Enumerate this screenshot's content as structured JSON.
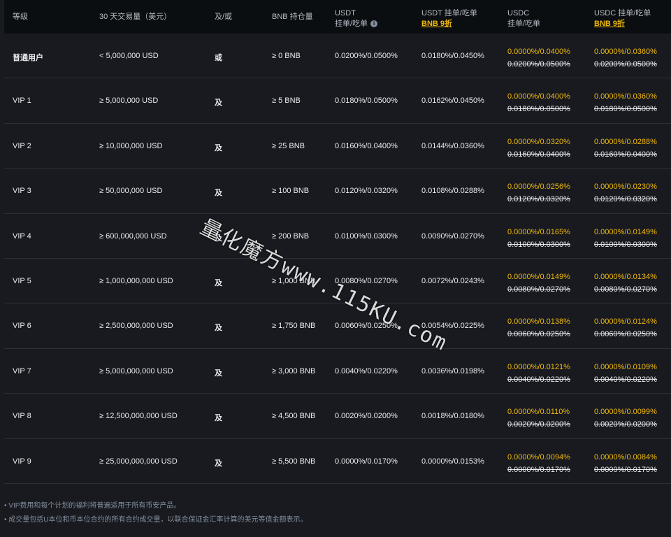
{
  "header": {
    "level": "等级",
    "volume": "30 天交易量（美元）",
    "andor": "及/或",
    "bnb": "BNB 持仓量",
    "usdt_title": "USDT",
    "usdt_sub": "挂单/吃单",
    "usdt_bnb_title": "USDT 挂单/吃单",
    "usdt_bnb_link": "BNB 9折",
    "usdc_title": "USDC",
    "usdc_sub": "挂单/吃单",
    "usdc_bnb_title": "USDC 挂单/吃单",
    "usdc_bnb_link": "BNB 9折"
  },
  "rows": [
    {
      "level": "普通用户",
      "volume": "< 5,000,000 USD",
      "andor": "或",
      "bnb": "≥ 0 BNB",
      "usdt": "0.0200%/0.0500%",
      "usdt_bnb": "0.0180%/0.0450%",
      "usdc_new": "0.0000%/0.0400%",
      "usdc_old": "0.0200%/0.0500%",
      "usdc_bnb_new": "0.0000%/0.0360%",
      "usdc_bnb_old": "0.0200%/0.0500%"
    },
    {
      "level": "VIP 1",
      "volume": "≥ 5,000,000 USD",
      "andor": "及",
      "bnb": "≥ 5 BNB",
      "usdt": "0.0180%/0.0500%",
      "usdt_bnb": "0.0162%/0.0450%",
      "usdc_new": "0.0000%/0.0400%",
      "usdc_old": "0.0180%/0.0500%",
      "usdc_bnb_new": "0.0000%/0.0360%",
      "usdc_bnb_old": "0.0180%/0.0500%"
    },
    {
      "level": "VIP 2",
      "volume": "≥ 10,000,000 USD",
      "andor": "及",
      "bnb": "≥ 25 BNB",
      "usdt": "0.0160%/0.0400%",
      "usdt_bnb": "0.0144%/0.0360%",
      "usdc_new": "0.0000%/0.0320%",
      "usdc_old": "0.0160%/0.0400%",
      "usdc_bnb_new": "0.0000%/0.0288%",
      "usdc_bnb_old": "0.0160%/0.0400%"
    },
    {
      "level": "VIP 3",
      "volume": "≥ 50,000,000 USD",
      "andor": "及",
      "bnb": "≥ 100 BNB",
      "usdt": "0.0120%/0.0320%",
      "usdt_bnb": "0.0108%/0.0288%",
      "usdc_new": "0.0000%/0.0256%",
      "usdc_old": "0.0120%/0.0320%",
      "usdc_bnb_new": "0.0000%/0.0230%",
      "usdc_bnb_old": "0.0120%/0.0320%"
    },
    {
      "level": "VIP 4",
      "volume": "≥ 600,000,000 USD",
      "andor": "及",
      "bnb": "≥ 200 BNB",
      "usdt": "0.0100%/0.0300%",
      "usdt_bnb": "0.0090%/0.0270%",
      "usdc_new": "0.0000%/0.0165%",
      "usdc_old": "0.0100%/0.0300%",
      "usdc_bnb_new": "0.0000%/0.0149%",
      "usdc_bnb_old": "0.0100%/0.0300%"
    },
    {
      "level": "VIP 5",
      "volume": "≥ 1,000,000,000 USD",
      "andor": "及",
      "bnb": "≥ 1,000 BNB",
      "usdt": "0.0080%/0.0270%",
      "usdt_bnb": "0.0072%/0.0243%",
      "usdc_new": "0.0000%/0.0149%",
      "usdc_old": "0.0080%/0.0270%",
      "usdc_bnb_new": "0.0000%/0.0134%",
      "usdc_bnb_old": "0.0080%/0.0270%"
    },
    {
      "level": "VIP 6",
      "volume": "≥ 2,500,000,000 USD",
      "andor": "及",
      "bnb": "≥ 1,750 BNB",
      "usdt": "0.0060%/0.0250%",
      "usdt_bnb": "0.0054%/0.0225%",
      "usdc_new": "0.0000%/0.0138%",
      "usdc_old": "0.0060%/0.0250%",
      "usdc_bnb_new": "0.0000%/0.0124%",
      "usdc_bnb_old": "0.0060%/0.0250%"
    },
    {
      "level": "VIP 7",
      "volume": "≥ 5,000,000,000 USD",
      "andor": "及",
      "bnb": "≥ 3,000 BNB",
      "usdt": "0.0040%/0.0220%",
      "usdt_bnb": "0.0036%/0.0198%",
      "usdc_new": "0.0000%/0.0121%",
      "usdc_old": "0.0040%/0.0220%",
      "usdc_bnb_new": "0.0000%/0.0109%",
      "usdc_bnb_old": "0.0040%/0.0220%"
    },
    {
      "level": "VIP 8",
      "volume": "≥ 12,500,000,000 USD",
      "andor": "及",
      "bnb": "≥ 4,500 BNB",
      "usdt": "0.0020%/0.0200%",
      "usdt_bnb": "0.0018%/0.0180%",
      "usdc_new": "0.0000%/0.0110%",
      "usdc_old": "0.0020%/0.0200%",
      "usdc_bnb_new": "0.0000%/0.0099%",
      "usdc_bnb_old": "0.0020%/0.0200%"
    },
    {
      "level": "VIP 9",
      "volume": "≥ 25,000,000,000 USD",
      "andor": "及",
      "bnb": "≥ 5,500 BNB",
      "usdt": "0.0000%/0.0170%",
      "usdt_bnb": "0.0000%/0.0153%",
      "usdc_new": "0.0000%/0.0094%",
      "usdc_old": "0.0000%/0.0170%",
      "usdc_bnb_new": "0.0000%/0.0084%",
      "usdc_bnb_old": "0.0000%/0.0170%"
    }
  ],
  "notes": [
    "VIP费用和每个计划的福利将普遍适用于所有币安产品。",
    "成交量包括U本位和币本位合约的所有合约成交量，以联合保证金汇率计算的美元等值金额表示。"
  ],
  "watermark": "量化魔方www.115KU.com",
  "colors": {
    "accent": "#f0b90b",
    "bg": "#181a20",
    "header_bg": "#0b0e11"
  }
}
